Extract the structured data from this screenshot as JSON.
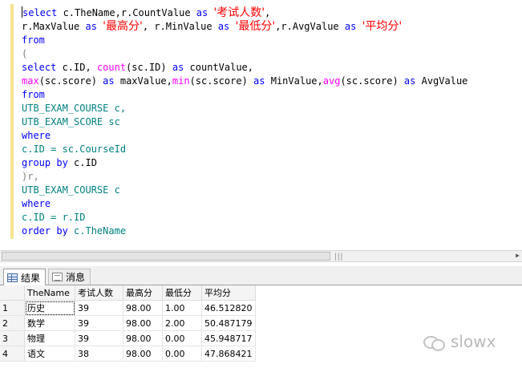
{
  "editor": {
    "lines": [
      [
        {
          "t": "select",
          "c": "kw"
        },
        {
          "t": " c.TheName"
        },
        {
          "t": ","
        },
        {
          "t": "r.CountValue "
        },
        {
          "t": "as",
          "c": "kw"
        },
        {
          "t": " "
        },
        {
          "t": "'考试人数'",
          "c": "str"
        },
        {
          "t": ","
        }
      ],
      [
        {
          "t": "r.MaxValue "
        },
        {
          "t": "as",
          "c": "kw"
        },
        {
          "t": " "
        },
        {
          "t": "'最高分'",
          "c": "str"
        },
        {
          "t": ", r.MinValue "
        },
        {
          "t": "as",
          "c": "kw"
        },
        {
          "t": " "
        },
        {
          "t": "'最低分'",
          "c": "str"
        },
        {
          "t": ",r.AvgValue "
        },
        {
          "t": "as",
          "c": "kw"
        },
        {
          "t": " "
        },
        {
          "t": "'平均分'",
          "c": "str"
        }
      ],
      [
        {
          "t": "from",
          "c": "kw"
        }
      ],
      [
        {
          "t": "(",
          "c": "op"
        }
      ],
      [
        {
          "t": "select",
          "c": "kw"
        },
        {
          "t": " c.ID, "
        },
        {
          "t": "count",
          "c": "fn"
        },
        {
          "t": "(sc.ID) "
        },
        {
          "t": "as",
          "c": "kw"
        },
        {
          "t": " countValue,"
        }
      ],
      [
        {
          "t": "max",
          "c": "fn"
        },
        {
          "t": "(sc.score) "
        },
        {
          "t": "as",
          "c": "kw"
        },
        {
          "t": " maxValue,"
        },
        {
          "t": "min",
          "c": "fn"
        },
        {
          "t": "(sc.score) "
        },
        {
          "t": "as",
          "c": "kw"
        },
        {
          "t": " MinValue,"
        },
        {
          "t": "avg",
          "c": "fn"
        },
        {
          "t": "(sc.score) "
        },
        {
          "t": "as",
          "c": "kw"
        },
        {
          "t": " AvgValue"
        }
      ],
      [
        {
          "t": "from",
          "c": "kw"
        }
      ],
      [
        {
          "t": "UTB_EXAM_COURSE c,",
          "c": "id"
        }
      ],
      [
        {
          "t": "UTB_EXAM_SCORE sc",
          "c": "id"
        }
      ],
      [
        {
          "t": "where",
          "c": "kw"
        }
      ],
      [
        {
          "t": "c.ID = sc.CourseId",
          "c": "id"
        }
      ],
      [
        {
          "t": "group by",
          "c": "kw"
        },
        {
          "t": " c.ID"
        }
      ],
      [
        {
          "t": ")r,",
          "c": "op"
        }
      ],
      [
        {
          "t": "UTB_EXAM_COURSE c",
          "c": "id"
        }
      ],
      [
        {
          "t": "where",
          "c": "kw"
        }
      ],
      [
        {
          "t": "c.ID = r.ID",
          "c": "id"
        }
      ],
      [
        {
          "t": "order by",
          "c": "kw"
        },
        {
          "t": " c.TheName",
          "c": "id"
        }
      ]
    ]
  },
  "tabs": {
    "results_label": "结果",
    "messages_label": "消息"
  },
  "grid": {
    "columns": [
      "TheName",
      "考试人数",
      "最高分",
      "最低分",
      "平均分"
    ],
    "rows": [
      {
        "num": "1",
        "cells": [
          "历史",
          "39",
          "98.00",
          "1.00",
          "46.512820"
        ]
      },
      {
        "num": "2",
        "cells": [
          "数学",
          "39",
          "98.00",
          "2.00",
          "50.487179"
        ]
      },
      {
        "num": "3",
        "cells": [
          "物理",
          "39",
          "98.00",
          "0.00",
          "45.948717"
        ]
      },
      {
        "num": "4",
        "cells": [
          "语文",
          "38",
          "98.00",
          "0.00",
          "47.868421"
        ]
      }
    ]
  },
  "watermark": {
    "text": "slowx"
  }
}
